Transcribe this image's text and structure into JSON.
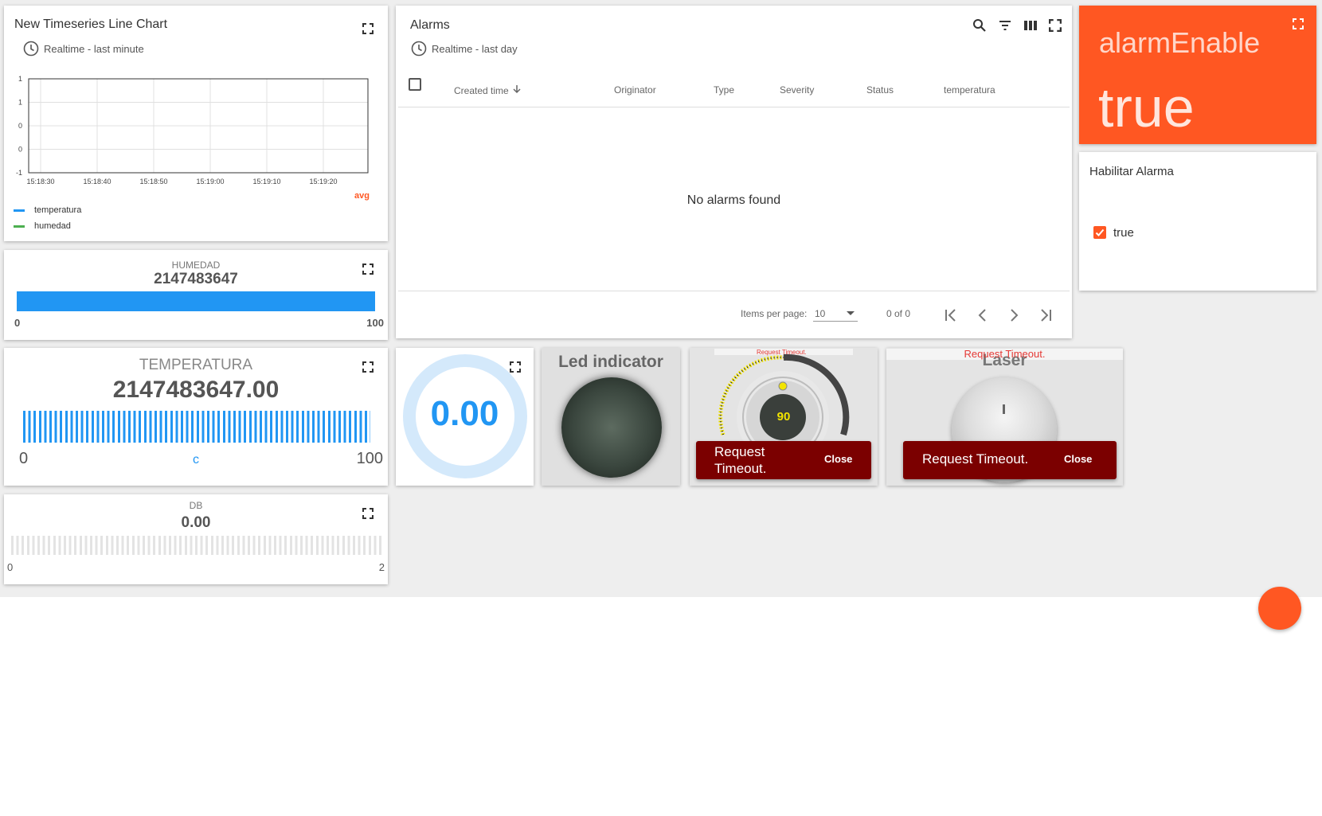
{
  "timeseries_widget": {
    "title": "New Timeseries Line Chart",
    "timewindow": "Realtime - last minute",
    "agg_label": "avg",
    "legend": [
      {
        "name": "temperatura",
        "color": "#2196f3"
      },
      {
        "name": "humedad",
        "color": "#4caf50"
      }
    ]
  },
  "chart_data": {
    "type": "line",
    "title": "",
    "x_ticks": [
      "15:18:30",
      "15:18:40",
      "15:18:50",
      "15:19:00",
      "15:19:10",
      "15:19:20"
    ],
    "y_ticks": [
      "1",
      "1",
      "0",
      "0",
      "-1"
    ],
    "series": [
      {
        "name": "temperatura",
        "values": []
      },
      {
        "name": "humedad",
        "values": []
      }
    ],
    "grid": true
  },
  "alarms_widget": {
    "title": "Alarms",
    "timewindow": "Realtime - last day",
    "columns": [
      "Created time",
      "Originator",
      "Type",
      "Severity",
      "Status",
      "temperatura"
    ],
    "empty_text": "No alarms found",
    "items_per_page_label": "Items per page:",
    "items_per_page_value": "10",
    "range_label": "0 of 0"
  },
  "alarm_enable_card": {
    "label": "alarmEnable",
    "value": "true",
    "bg_color": "#ff5722"
  },
  "habilitar_card": {
    "title": "Habilitar Alarma",
    "checkbox_label": "true",
    "checked": true
  },
  "humedad_widget": {
    "label": "HUMEDAD",
    "value": "2147483647",
    "min": "0",
    "max": "100",
    "fill": 1.0
  },
  "temperatura_widget": {
    "label": "TEMPERATURA",
    "value": "2147483647.00",
    "min": "0",
    "max": "100",
    "unit": "c",
    "fill": 1.0
  },
  "db_widget": {
    "label": "DB",
    "value": "0.00",
    "min": "0",
    "max": "2",
    "fill": 0.0
  },
  "donut_widget": {
    "value": "0.00",
    "fill": 0.0
  },
  "led_widget": {
    "title": "Led indicator"
  },
  "knob_widget": {
    "value": "90",
    "top_error": "Request Timeout.",
    "snack_message": "Request Timeout.",
    "snack_close": "Close"
  },
  "laser_widget": {
    "title": "Laser",
    "top_error": "Request Timeout.",
    "snack_message": "Request Timeout.",
    "snack_close": "Close"
  },
  "colors": {
    "accent": "#ff5722",
    "primary_blue": "#2196f3",
    "snack_bg": "#7b0000",
    "error_red": "#e53935"
  }
}
